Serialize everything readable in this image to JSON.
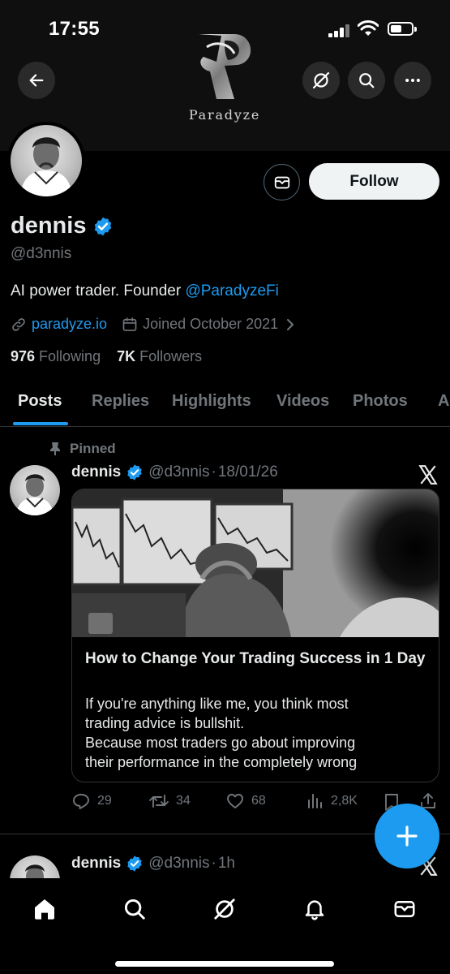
{
  "status_bar": {
    "time": "17:55"
  },
  "header": {
    "brand_name": "Paradyze",
    "back_icon": "arrow-left-icon",
    "grok_icon": "grok-icon",
    "search_icon": "search-icon",
    "more_icon": "more-icon"
  },
  "profile": {
    "display_name": "dennis",
    "handle": "@d3nnis",
    "bio_text": "AI power trader. Founder ",
    "bio_mention": "@ParadyzeFi",
    "website": "paradyze.io",
    "joined": "Joined October 2021",
    "following_count": "976",
    "following_label": " Following",
    "followers_count": "7K",
    "followers_label": " Followers",
    "follow_label": "Follow"
  },
  "tabs": [
    {
      "label": "Posts",
      "active": true
    },
    {
      "label": "Replies",
      "active": false
    },
    {
      "label": "Highlights",
      "active": false
    },
    {
      "label": "Videos",
      "active": false
    },
    {
      "label": "Photos",
      "active": false
    },
    {
      "label": "A",
      "active": false
    }
  ],
  "posts": [
    {
      "pinned_label": "Pinned",
      "author": "dennis",
      "handle": "@d3nnis",
      "time": "18/01/26",
      "article": {
        "title": "How to Change Your Trading Success in 1 Day",
        "desc_lines": [
          "If you're anything like me, you think most",
          "trading advice is bullshit.",
          "Because most traders go about improving",
          "their performance in the completely wrong"
        ]
      },
      "stats": {
        "replies": "29",
        "reposts": "34",
        "likes": "68",
        "views": "2,8K"
      }
    },
    {
      "author": "dennis",
      "handle": "@d3nnis",
      "time": "1h"
    }
  ],
  "colors": {
    "accent": "#1d9bf0",
    "background": "#000000",
    "text_primary": "#e7e9ea",
    "text_secondary": "#71767b",
    "border": "#2f3336"
  },
  "bottom_nav": [
    "home-icon",
    "search-icon",
    "grok-icon",
    "notifications-icon",
    "messages-icon"
  ]
}
